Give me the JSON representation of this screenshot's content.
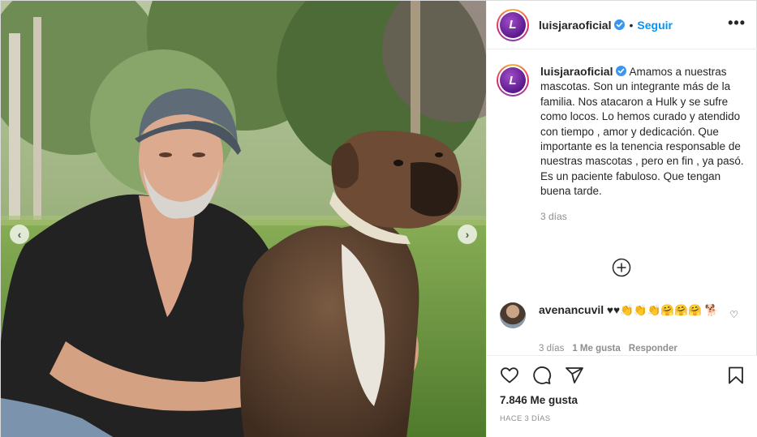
{
  "account": {
    "username": "luisjaraoficial",
    "avatar_letter": "L",
    "separator": "•",
    "follow_label": "Seguir",
    "more_label": "•••"
  },
  "caption": {
    "username": "luisjaraoficial",
    "text": "Amamos a nuestras mascotas. Son un integrante más de la familia. Nos atacaron a Hulk y se sufre como locos. Lo hemos curado y atendido con tiempo , amor y dedicación. Que importante es la tenencia responsable de nuestras mascotas , pero en fin , ya pasó. Es un paciente fabuloso. Que tengan buena tarde.",
    "time": "3 días"
  },
  "comments": [
    {
      "username": "avenancuvil",
      "text": "♥♥👏👏👏🤗🤗🤗 🐕",
      "time": "3 días",
      "likes": "1 Me gusta",
      "reply_label": "Responder"
    }
  ],
  "stats": {
    "likes": "7.846 Me gusta",
    "date": "HACE 3 DÍAS"
  },
  "photo": {
    "nav_prev": "‹",
    "nav_next": "›"
  },
  "colors": {
    "accent": "#0095f6",
    "text": "#262626",
    "muted": "#8e8e8e",
    "border": "#efefef"
  }
}
